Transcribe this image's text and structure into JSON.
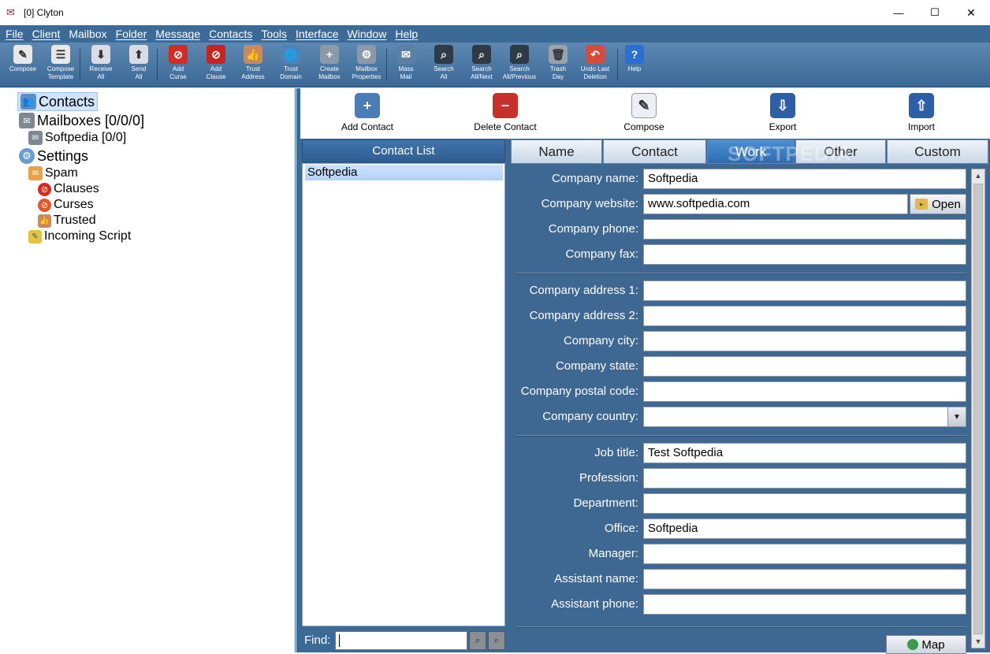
{
  "window": {
    "title": "[0] Clyton",
    "minimize": "—",
    "maximize": "☐",
    "close": "✕"
  },
  "menu": [
    "File",
    "Client",
    "Mailbox",
    "Folder",
    "Message",
    "Contacts",
    "Tools",
    "Interface",
    "Window",
    "Help"
  ],
  "toolbar": [
    {
      "label": "Compose",
      "icon": "compose-icon",
      "color": "#e8e8e8",
      "glyph": "✎"
    },
    {
      "label": "Compose\nTemplate",
      "icon": "template-icon",
      "color": "#e8e8e8",
      "glyph": "☰"
    },
    {
      "label": "Receive\nAll",
      "icon": "receive-icon",
      "color": "#d9dde3",
      "glyph": "⬇"
    },
    {
      "label": "Send\nAll",
      "icon": "send-icon",
      "color": "#d9dde3",
      "glyph": "⬆"
    },
    {
      "label": "Add\nCurse",
      "icon": "curse-icon",
      "color": "#d62b1f",
      "glyph": "⊘"
    },
    {
      "label": "Add\nClause",
      "icon": "clause-icon",
      "color": "#c8241b",
      "glyph": "⊘"
    },
    {
      "label": "Trust\nAddress",
      "icon": "trust-address-icon",
      "color": "#c98a5d",
      "glyph": "👍"
    },
    {
      "label": "Trust\nDomain",
      "icon": "trust-domain-icon",
      "color": "#4f82b8",
      "glyph": "🌐"
    },
    {
      "label": "Create\nMailbox",
      "icon": "create-mailbox-icon",
      "color": "#8c9aa8",
      "glyph": "+"
    },
    {
      "label": "Mailbox\nProperties",
      "icon": "mailbox-properties-icon",
      "color": "#8c9aa8",
      "glyph": "⚙"
    },
    {
      "label": "Mass\nMail",
      "icon": "mass-mail-icon",
      "color": "#5c7fa6",
      "glyph": "✉"
    },
    {
      "label": "Search\nAll",
      "icon": "search-all-icon",
      "color": "#2f3a44",
      "glyph": "⌕"
    },
    {
      "label": "Search\nAll/Next",
      "icon": "search-next-icon",
      "color": "#2f3a44",
      "glyph": "⌕"
    },
    {
      "label": "Search\nAll/Previous",
      "icon": "search-previous-icon",
      "color": "#2f3a44",
      "glyph": "⌕"
    },
    {
      "label": "Trash\nDay",
      "icon": "trash-icon",
      "color": "#9aa2aa",
      "glyph": "🗑"
    },
    {
      "label": "Undo Last\nDeletion",
      "icon": "undo-deletion-icon",
      "color": "#d94a3a",
      "glyph": "↶"
    },
    {
      "label": "Help",
      "icon": "help-icon",
      "color": "#2a6fd1",
      "glyph": "?"
    }
  ],
  "tree": {
    "contacts": "Contacts",
    "mailboxes": "Mailboxes [0/0/0]",
    "softpedia": "Softpedia [0/0]",
    "settings": "Settings",
    "spam": "Spam",
    "clauses": "Clauses",
    "curses": "Curses",
    "trusted": "Trusted",
    "incoming_script": "Incoming Script"
  },
  "actions": {
    "add_contact": "Add Contact",
    "delete_contact": "Delete Contact",
    "compose": "Compose",
    "export": "Export",
    "import": "Import"
  },
  "contact_list": {
    "header": "Contact List",
    "items": [
      "Softpedia"
    ],
    "find_label": "Find:",
    "find_value": ""
  },
  "tabs": [
    "Name",
    "Contact",
    "Work",
    "Other",
    "Custom"
  ],
  "active_tab": "Work",
  "watermark": "SOFTPEDIA",
  "fields": {
    "company_name": {
      "label": "Company name:",
      "value": "Softpedia"
    },
    "company_website": {
      "label": "Company website:",
      "value": "www.softpedia.com"
    },
    "company_phone": {
      "label": "Company phone:",
      "value": ""
    },
    "company_fax": {
      "label": "Company fax:",
      "value": ""
    },
    "company_address1": {
      "label": "Company address 1:",
      "value": ""
    },
    "company_address2": {
      "label": "Company address 2:",
      "value": ""
    },
    "company_city": {
      "label": "Company city:",
      "value": ""
    },
    "company_state": {
      "label": "Company state:",
      "value": ""
    },
    "company_postal": {
      "label": "Company postal code:",
      "value": ""
    },
    "company_country": {
      "label": "Company country:",
      "value": ""
    },
    "job_title": {
      "label": "Job title:",
      "value": "Test Softpedia"
    },
    "profession": {
      "label": "Profession:",
      "value": ""
    },
    "department": {
      "label": "Department:",
      "value": ""
    },
    "office": {
      "label": "Office:",
      "value": "Softpedia"
    },
    "manager": {
      "label": "Manager:",
      "value": ""
    },
    "assistant_name": {
      "label": "Assistant name:",
      "value": ""
    },
    "assistant_phone": {
      "label": "Assistant phone:",
      "value": ""
    }
  },
  "buttons": {
    "open": "Open",
    "map": "Map"
  }
}
